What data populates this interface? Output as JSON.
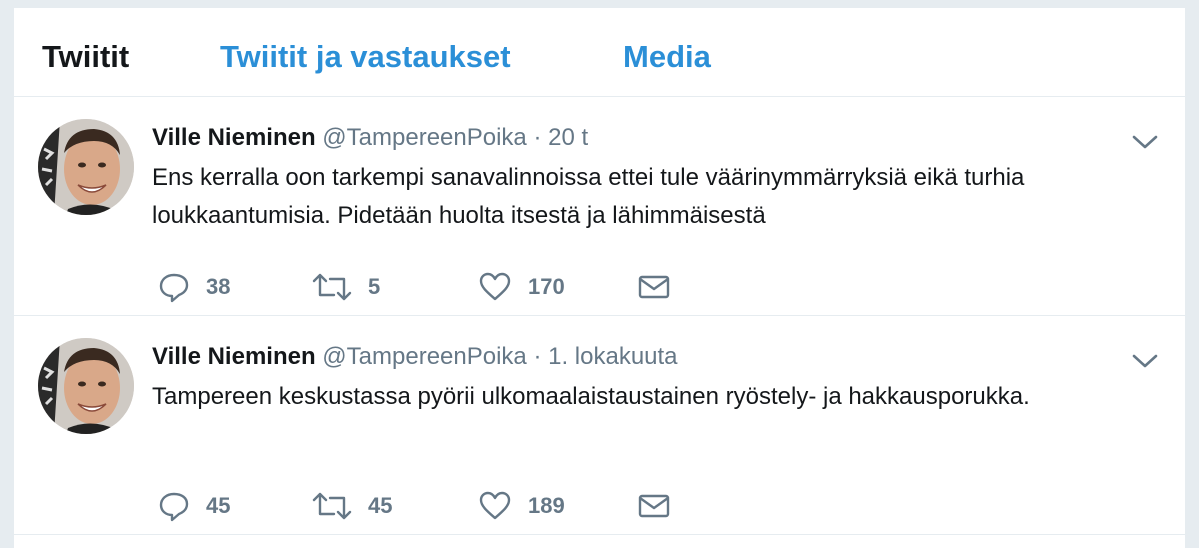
{
  "tabs": [
    {
      "label": "Twiitit",
      "active": true
    },
    {
      "label": "Twiitit ja vastaukset",
      "active": false
    },
    {
      "label": "Media",
      "active": false
    }
  ],
  "colors": {
    "accent": "#2b8fd7",
    "text": "#14171a",
    "muted": "#657786"
  },
  "tweets": [
    {
      "name": "Ville Nieminen",
      "handle": "@TampereenPoika",
      "separator": "·",
      "time": "20 t",
      "text": "Ens kerralla oon tarkempi sanavalinnoissa ettei tule väärinymmärryksiä eikä turhia loukkaantumisia. Pidetään huolta itsestä ja lähimmäisestä",
      "replies": "38",
      "retweets": "5",
      "likes": "170"
    },
    {
      "name": "Ville Nieminen",
      "handle": "@TampereenPoika",
      "separator": "·",
      "time": "1. lokakuuta",
      "text": "Tampereen keskustassa pyörii ulkomaalaistaustainen ryöstely- ja hakkausporukka.",
      "replies": "45",
      "retweets": "45",
      "likes": "189"
    }
  ],
  "icons": [
    "reply-icon",
    "retweet-icon",
    "like-icon",
    "direct-message-icon",
    "chevron-down-icon"
  ]
}
